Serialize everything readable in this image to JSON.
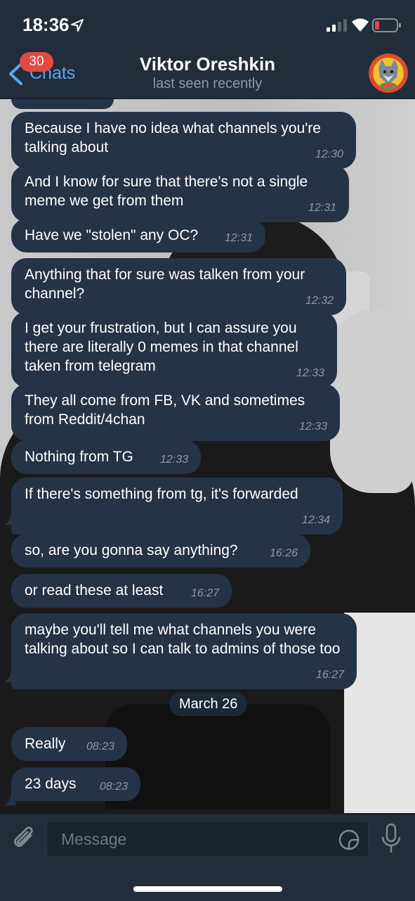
{
  "status_bar": {
    "time": "18:36"
  },
  "nav": {
    "back_label": "Chats",
    "unread_badge": "30",
    "title": "Viktor Oreshkin",
    "subtitle": "last seen recently"
  },
  "messages": [
    {
      "text": "Because I have no idea what channels you're talking about",
      "time": "12:30"
    },
    {
      "text": "And I know for sure that there's not a single meme we get from them",
      "time": "12:31"
    },
    {
      "text": "Have we \"stolen\" any OC?",
      "time": "12:31"
    },
    {
      "text": "Anything that for sure was talken from your channel?",
      "time": "12:32"
    },
    {
      "text": "I get your frustration, but I can assure you there are literally 0 memes in that channel taken from telegram",
      "time": "12:33"
    },
    {
      "text": "They all come from FB, VK and sometimes from Reddit/4chan",
      "time": "12:33"
    },
    {
      "text": "Nothing from TG",
      "time": "12:33"
    },
    {
      "text": "If there's something from tg, it's forwarded",
      "time": "12:34"
    },
    {
      "text": "so, are you gonna say anything?",
      "time": "16:26"
    },
    {
      "text": "or read these at least",
      "time": "16:27"
    },
    {
      "text": "maybe you'll tell me what channels you were talking about so I can talk to admins of those too",
      "time": "16:27"
    },
    {
      "text": "Really",
      "time": "08:23"
    },
    {
      "text": "23 days",
      "time": "08:23"
    }
  ],
  "date_separator": "March 26",
  "input": {
    "placeholder": "Message"
  },
  "colors": {
    "header_bg": "#212d3b",
    "bubble_bg": "#253347",
    "accent": "#59a6ec",
    "badge": "#e5483f",
    "time_text": "#8b98a8"
  }
}
